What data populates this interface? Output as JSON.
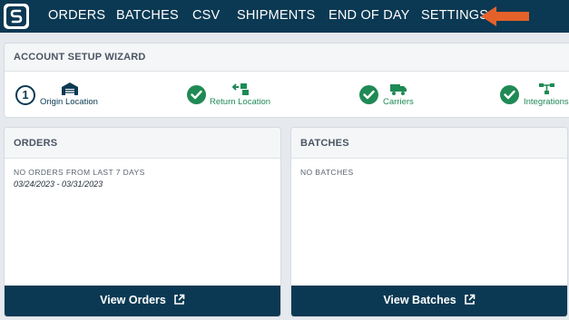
{
  "nav": {
    "items": [
      "ORDERS",
      "BATCHES",
      "CSV",
      "SHIPMENTS",
      "END OF DAY",
      "SETTINGS"
    ]
  },
  "wizard": {
    "title": "ACCOUNT SETUP WIZARD",
    "current_step_number": "1",
    "steps": [
      {
        "label": "Origin Location",
        "icon": "warehouse-icon",
        "status": "current"
      },
      {
        "label": "Return Location",
        "icon": "return-box-icon",
        "status": "done"
      },
      {
        "label": "Carriers",
        "icon": "truck-icon",
        "status": "done"
      },
      {
        "label": "Integrations",
        "icon": "integrations-icon",
        "status": "done"
      }
    ]
  },
  "orders": {
    "title": "ORDERS",
    "note": "NO ORDERS FROM LAST 7 DAYS",
    "range": "03/24/2023 - 03/31/2023",
    "button": "View Orders"
  },
  "batches": {
    "title": "BATCHES",
    "note": "NO BATCHES",
    "button": "View Batches"
  },
  "colors": {
    "nav_bg": "#0b3953",
    "success": "#1f8a55",
    "arrow": "#e4622a"
  }
}
